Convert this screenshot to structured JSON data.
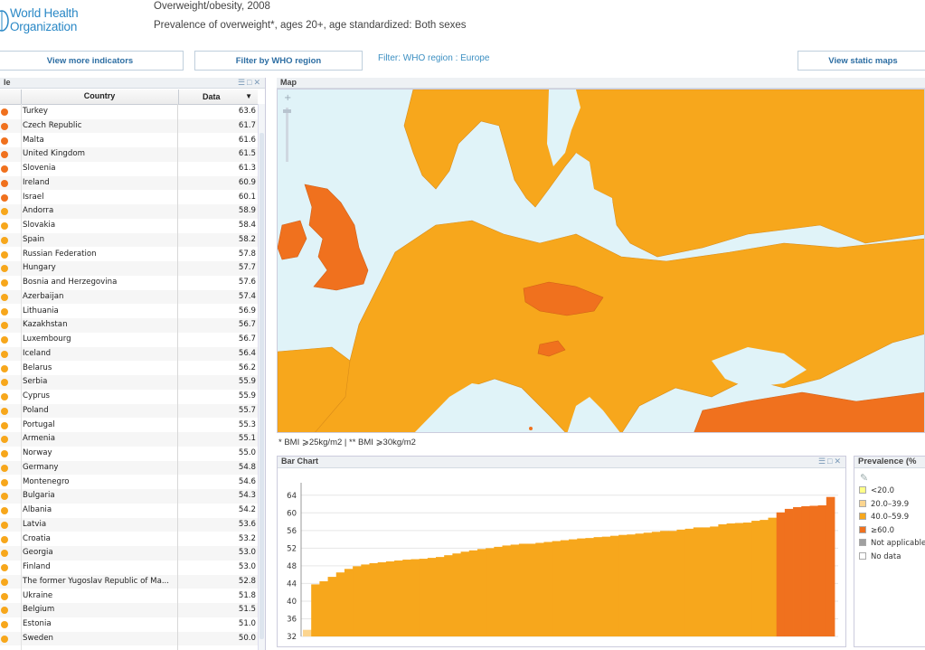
{
  "header": {
    "logo_line1": "World Health",
    "logo_line2": "Organization",
    "title": "Overweight/obesity, 2008",
    "subtitle": "Prevalence of overweight*, ages 20+, age standardized:  Both sexes"
  },
  "buttons": {
    "more_indicators": "View more indicators",
    "filter_region": "Filter by WHO region",
    "static_maps": "View static maps"
  },
  "filter_text": "Filter:  WHO region :  Europe",
  "table": {
    "panel_title": "le",
    "col_country": "Country",
    "col_data": "Data",
    "sort_icon": "▼",
    "rows": [
      {
        "country": "Turkey",
        "value": "63.6",
        "color": "#f0711e"
      },
      {
        "country": "Czech Republic",
        "value": "61.7",
        "color": "#f0711e"
      },
      {
        "country": "Malta",
        "value": "61.6",
        "color": "#f0711e"
      },
      {
        "country": "United Kingdom",
        "value": "61.5",
        "color": "#f0711e"
      },
      {
        "country": "Slovenia",
        "value": "61.3",
        "color": "#f0711e"
      },
      {
        "country": "Ireland",
        "value": "60.9",
        "color": "#f0711e"
      },
      {
        "country": "Israel",
        "value": "60.1",
        "color": "#f0711e"
      },
      {
        "country": "Andorra",
        "value": "58.9",
        "color": "#f7a71c"
      },
      {
        "country": "Slovakia",
        "value": "58.4",
        "color": "#f7a71c"
      },
      {
        "country": "Spain",
        "value": "58.2",
        "color": "#f7a71c"
      },
      {
        "country": "Russian Federation",
        "value": "57.8",
        "color": "#f7a71c"
      },
      {
        "country": "Hungary",
        "value": "57.7",
        "color": "#f7a71c"
      },
      {
        "country": "Bosnia and Herzegovina",
        "value": "57.6",
        "color": "#f7a71c"
      },
      {
        "country": "Azerbaijan",
        "value": "57.4",
        "color": "#f7a71c"
      },
      {
        "country": "Lithuania",
        "value": "56.9",
        "color": "#f7a71c"
      },
      {
        "country": "Kazakhstan",
        "value": "56.7",
        "color": "#f7a71c"
      },
      {
        "country": "Luxembourg",
        "value": "56.7",
        "color": "#f7a71c"
      },
      {
        "country": "Iceland",
        "value": "56.4",
        "color": "#f7a71c"
      },
      {
        "country": "Belarus",
        "value": "56.2",
        "color": "#f7a71c"
      },
      {
        "country": "Serbia",
        "value": "55.9",
        "color": "#f7a71c"
      },
      {
        "country": "Cyprus",
        "value": "55.9",
        "color": "#f7a71c"
      },
      {
        "country": "Poland",
        "value": "55.7",
        "color": "#f7a71c"
      },
      {
        "country": "Portugal",
        "value": "55.3",
        "color": "#f7a71c"
      },
      {
        "country": "Armenia",
        "value": "55.1",
        "color": "#f7a71c"
      },
      {
        "country": "Norway",
        "value": "55.0",
        "color": "#f7a71c"
      },
      {
        "country": "Germany",
        "value": "54.8",
        "color": "#f7a71c"
      },
      {
        "country": "Montenegro",
        "value": "54.6",
        "color": "#f7a71c"
      },
      {
        "country": "Bulgaria",
        "value": "54.3",
        "color": "#f7a71c"
      },
      {
        "country": "Albania",
        "value": "54.2",
        "color": "#f7a71c"
      },
      {
        "country": "Latvia",
        "value": "53.6",
        "color": "#f7a71c"
      },
      {
        "country": "Croatia",
        "value": "53.2",
        "color": "#f7a71c"
      },
      {
        "country": "Georgia",
        "value": "53.0",
        "color": "#f7a71c"
      },
      {
        "country": "Finland",
        "value": "53.0",
        "color": "#f7a71c"
      },
      {
        "country": "The former Yugoslav Republic of Ma...",
        "value": "52.8",
        "color": "#f7a71c"
      },
      {
        "country": "Ukraine",
        "value": "51.8",
        "color": "#f7a71c"
      },
      {
        "country": "Belgium",
        "value": "51.5",
        "color": "#f7a71c"
      },
      {
        "country": "Estonia",
        "value": "51.0",
        "color": "#f7a71c"
      },
      {
        "country": "Sweden",
        "value": "50.0",
        "color": "#f7a71c"
      }
    ]
  },
  "map": {
    "panel_title": "Map",
    "zoom_in": "+",
    "zoom_out": "-",
    "colors": {
      "sea": "#e0f3f8",
      "mid": "#f7a71c",
      "high": "#f0711e",
      "border": "#d98c1a"
    }
  },
  "footnote": "* BMI ⩾25kg/m2   | ** BMI ⩾30kg/m2",
  "bar_panel_title": "Bar Chart",
  "legend": {
    "title": "Prevalence (%",
    "items": [
      {
        "label": "<20.0",
        "color": "#ffff88"
      },
      {
        "label": "20.0–39.9",
        "color": "#fcd58f"
      },
      {
        "label": "40.0–59.9",
        "color": "#f7a71c"
      },
      {
        "label": "≥60.0",
        "color": "#f0711e"
      },
      {
        "label": "Not applicable",
        "color": "#a0a0a0"
      },
      {
        "label": "No data",
        "color": "#ffffff"
      }
    ]
  },
  "chart_data": {
    "type": "bar",
    "ylim": [
      32,
      66
    ],
    "yticks": [
      32,
      36,
      40,
      44,
      48,
      52,
      56,
      60,
      64
    ],
    "grid": true,
    "values": [
      33.5,
      43.8,
      44.5,
      45.5,
      46.5,
      47.3,
      47.9,
      48.3,
      48.6,
      48.8,
      49.0,
      49.2,
      49.4,
      49.5,
      49.6,
      49.8,
      50.0,
      50.4,
      50.8,
      51.2,
      51.5,
      51.8,
      52.0,
      52.3,
      52.6,
      52.8,
      53.0,
      53.0,
      53.2,
      53.4,
      53.6,
      53.8,
      54.0,
      54.2,
      54.3,
      54.5,
      54.6,
      54.8,
      55.0,
      55.1,
      55.3,
      55.5,
      55.7,
      55.9,
      55.9,
      56.2,
      56.4,
      56.7,
      56.7,
      56.9,
      57.4,
      57.6,
      57.7,
      57.8,
      58.2,
      58.4,
      58.9,
      60.1,
      60.9,
      61.3,
      61.5,
      61.6,
      61.7,
      63.6
    ],
    "colors_by_band": {
      "low": "#fcd58f",
      "mid": "#f7a71c",
      "high": "#f0711e"
    }
  }
}
